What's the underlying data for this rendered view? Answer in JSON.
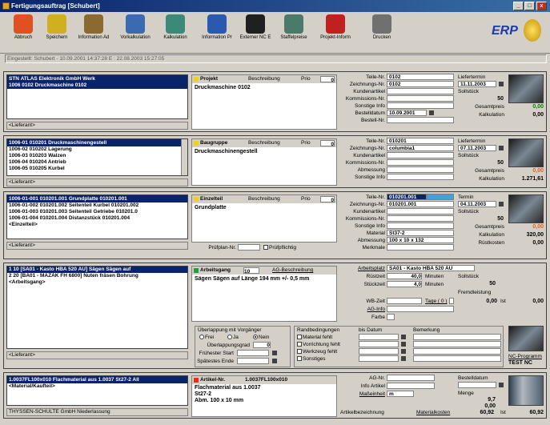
{
  "window": {
    "title": "Fertigungsauftrag  [Schubert]",
    "btn_min": "_",
    "btn_max": "□",
    "btn_close": "x"
  },
  "toolbar": {
    "items": [
      {
        "label": "Abbruch",
        "icon": "abort-icon",
        "color": "#e05020"
      },
      {
        "label": "Speichern",
        "icon": "check-icon",
        "color": "#d0b020"
      },
      {
        "label": "Information Ad",
        "icon": "info-hand-icon",
        "color": "#8a6a30"
      },
      {
        "label": "Vorkalkulation",
        "icon": "calc-sheet-icon",
        "color": "#3a6ab0"
      },
      {
        "label": "Kalkulation",
        "icon": "calculator-icon",
        "color": "#3a8a7a"
      },
      {
        "label": "Information Pr",
        "icon": "info-icon",
        "color": "#2a5ab0"
      },
      {
        "label": "Externer NC E",
        "icon": "nc-icon",
        "color": "#202020"
      },
      {
        "label": "Staffelpreise",
        "icon": "price-list-icon",
        "color": "#4a7a6a"
      },
      {
        "label": "Projekt-Inform",
        "icon": "project-info-icon",
        "color": "#c02020"
      },
      {
        "label": "Drucken",
        "icon": "printer-icon",
        "color": "#707070"
      }
    ],
    "logo": "ERP"
  },
  "status": "Eingestellt: Schubert - 10.09.2001 14:37:28      E : 22.08.2003 15:27:05",
  "project": {
    "list_header": "STN ATLAS Elektronik GmbH Werk",
    "list_rows": [
      "1006 0102 Druckmaschine 0102"
    ],
    "footer": "<Lieferant>",
    "kind": "Projekt",
    "desc_label": "Beschreibung",
    "prio_label": "Prio",
    "prio": "0",
    "text": "Druckmaschine 0102",
    "f_teil_l": "Teile-Nr.",
    "f_teil": "0102",
    "f_zeich_l": "Zeichnungs-Nr.",
    "f_zeich": "0102",
    "f_kunde_l": "Kundenartikel",
    "f_komm_l": "Kommissions-Nr.",
    "f_sonst_l": "Sonstige Info",
    "f_best_l": "Bestelldatum",
    "f_best": "10.09.2001",
    "f_bestnr_l": "Bestell-Nr.",
    "r_lief_l": "Liefertermin",
    "r_lief": "11.11.2003",
    "r_soll_l": "Sollstück",
    "r_soll": "50",
    "r_gp_l": "Gesamtpreis",
    "r_gp": "0,00",
    "r_kalk_l": "Kalkulation",
    "r_kalk": "0,00"
  },
  "assembly": {
    "list_header": "1006-01 010201 Druckmaschinengestell",
    "list_rows": [
      "1006-02 010202 Lagerung",
      "1006-03 010203 Walzen",
      "1006-04 010204 Antrieb",
      "1006-05 010205 Kurbel"
    ],
    "footer": "<Lieferant>",
    "kind": "Baugruppe",
    "desc_label": "Beschreibung",
    "prio_label": "Prio",
    "prio": "0",
    "text": "Druckmaschinengestell",
    "f_teil_l": "Teile-Nr.",
    "f_teil": "010201",
    "f_zeich_l": "Zeichnungs-Nr.",
    "f_zeich": "columbia1",
    "f_kunde_l": "Kundenartikel",
    "f_komm_l": "Kommissions-Nr.",
    "f_abm_l": "Abmessung",
    "f_sonst_l": "Sonstige Info",
    "r_lief_l": "Liefertermin",
    "r_lief": "07.11.2003",
    "r_soll_l": "Sollstück",
    "r_soll": "50",
    "r_gp_l": "Gesamtpreis",
    "r_gp": "0,00",
    "r_kalk_l": "Kalkulation",
    "r_kalk": "1.271,61"
  },
  "part": {
    "list_header": "1006-01-001 010201.001 Grundplatte 010201.001",
    "list_rows": [
      "1006-01-002 010201.002 Seitenteil Kurbel 010201.002",
      "1006-01-003 010201.003 Seitenteil Getriebe 010201.0",
      "1006-01-004 010201.004 Distanzstück 010201.004",
      "<Einzelteil>"
    ],
    "footer": "<Lieferant>",
    "kind": "Einzelteil",
    "desc_label": "Beschreibung",
    "prio_label": "Prio",
    "prio": "0",
    "text": "Grundplatte",
    "pruef_l": "Prüfplan-Nr.",
    "pruefpfl": "Prüfpflichtig",
    "f_teil_l": "Teile-Nr.",
    "f_teil": "010201.001",
    "f_zeich_l": "Zeichnungs-Nr.",
    "f_zeich": "010201.001",
    "f_kunde_l": "Kundenartikel",
    "f_komm_l": "Kommissions-Nr.",
    "f_sonst_l": "Sonstige Info",
    "f_mat_l": "Material",
    "f_mat": "St37-2",
    "f_abm_l": "Abmessung",
    "f_abm": "100 x 10 x 132",
    "f_merk_l": "Merkmale",
    "r_lief_l": "Termin",
    "r_lief": "04.11.2003",
    "r_soll_l": "Sollstück",
    "r_soll": "50",
    "r_gp_l": "Gesamtpreis",
    "r_gp": "0,00",
    "r_kalk_l": "Kalkulation",
    "r_kalk": "320,00",
    "r_rk_l": "Rüstkosten",
    "r_rk": "0,00"
  },
  "operation": {
    "list_rows": [
      "1  10 [SA01 - Kasto HBA 520 AU] Sägen Sägen auf",
      "2  20 [BA01 - MAZAK FH 6800] Nuten fräsen Bohrung",
      "<Arbeitsgang>"
    ],
    "footer": "<Lieferant>",
    "kind": "Arbeitsgang",
    "num": "10",
    "desc_label": "AG-Beschreibung",
    "text": "Sägen Sägen auf Länge 194 mm +/- 0,5 mm",
    "ap_l": "Arbeitsplatz",
    "ap": "SA01 - Kasto HBA 520 AU",
    "rz_l": "Rüstzeit",
    "rz": "40,0",
    "rz_u": "Minuten",
    "sz_l": "Stückzeit",
    "sz": "4,0",
    "sz_u": "Minuten",
    "soll_l": "Sollstück",
    "soll": "50",
    "fremd_l": "Fremdleistung",
    "wb_l": "WB-Zeit",
    "tage_l": "Tage ( 0 )",
    "ist_v": "0,00",
    "ist_l": "Ist",
    "ist2": "0,00",
    "aginfo_l": "AG-Info",
    "farbe_l": "Farbe",
    "ov_title": "Überlappung mit Vorgänger",
    "ov_frei": "Frei",
    "ov_ja": "Ja",
    "ov_nein": "Nein",
    "ov_grad_l": "Überlappungsgrad",
    "ov_grad": "0",
    "ov_start_l": "Frühester Start",
    "ov_ende_l": "Spätestes Ende",
    "rb_title": "Randbedingungen",
    "rb_items": [
      "Material fehlt",
      "Vorrichtung fehlt",
      "Werkzeug fehlt",
      "Sonstiges"
    ],
    "bis_l": "bis Datum",
    "bem_l": "Bemerkung",
    "nc_l": "NC-Programm",
    "nc": "TEST NC"
  },
  "article": {
    "list_header": "1.0037FL100x010 Flachmaterial  aus 1.0037 St27-2 All",
    "list_rows": [
      "<Material/Kaufteil>"
    ],
    "footer": "THYSSEN-SCHULTE GmbH Niederlassung",
    "kind": "Artikel-Nr.",
    "num": "1.0037FL100x010",
    "lines": [
      "Flachmaterial  aus 1.0037",
      "St27-2",
      "Abm. 100 x 10 mm"
    ],
    "ag_l": "AG-Nr.",
    "info_l": "Info Artikel",
    "me_l": "Maßeinheit",
    "me": "m",
    "bd_l": "Bestelldatum",
    "menge_l": "Menge",
    "menge": "9,7",
    "v1": "0,00",
    "bez_l": "Artikelbezeichnung",
    "mk_l": "Materialkosten",
    "mk": "60,92",
    "ist_l": "Ist",
    "ist": "60,92"
  }
}
